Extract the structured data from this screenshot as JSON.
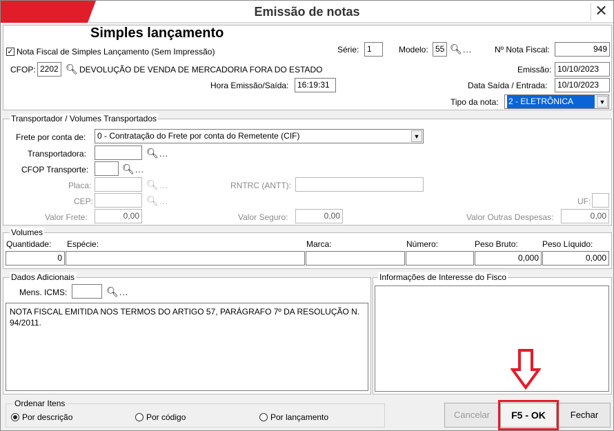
{
  "window": {
    "title": "Emissão de notas",
    "close_glyph": "✕"
  },
  "header": {
    "heading": "Simples lançamento",
    "checkbox_label": "Nota Fiscal de Simples Lançamento (Sem Impressão)",
    "serie_label": "Série:",
    "serie_value": "1",
    "modelo_label": "Modelo:",
    "modelo_value": "55",
    "numero_label": "Nº Nota Fiscal:",
    "numero_value": "949",
    "cfop_label": "CFOP:",
    "cfop_value": "2202",
    "cfop_desc": "DEVOLUÇÃO DE VENDA DE MERCADORIA FORA DO ESTADO",
    "hora_label": "Hora Emissão/Saída:",
    "hora_value": "16:19:31",
    "emissao_label": "Emissão:",
    "emissao_value": "10/10/2023",
    "saida_label": "Data Saída / Entrada:",
    "saida_value": "10/10/2023",
    "tipo_label": "Tipo da nota:",
    "tipo_value": "2 - ELETRÔNICA"
  },
  "transporte": {
    "title": "Transportador /  Volumes Transportados",
    "frete_label": "Frete por conta de:",
    "frete_value": "0 - Contratação do Frete por conta do Remetente (CIF)",
    "transportadora_label": "Transportadora:",
    "cfop_transp_label": "CFOP Transporte:",
    "placa_label": "Placa:",
    "rntrc_label": "RNTRC (ANTT):",
    "cep_label": "CEP:",
    "uf_label": "UF:",
    "valor_frete_label": "Valor Frete:",
    "valor_frete_value": "0,00",
    "valor_seguro_label": "Valor Seguro:",
    "valor_seguro_value": "0,00",
    "valor_outras_label": "Valor Outras Despesas:",
    "valor_outras_value": "0,00"
  },
  "volumes": {
    "title": "Volumes",
    "quantidade_label": "Quantidade:",
    "quantidade_value": "0",
    "especie_label": "Espécie:",
    "marca_label": "Marca:",
    "numero_label": "Número:",
    "peso_bruto_label": "Peso Bruto:",
    "peso_bruto_value": "0,000",
    "peso_liquido_label": "Peso Líquido:",
    "peso_liquido_value": "0,000"
  },
  "adicionais": {
    "title": "Dados Adicionais",
    "mens_label": "Mens. ICMS:",
    "text": "NOTA FISCAL EMITIDA NOS TERMOS DO ARTIGO 57, PARÁGRAFO 7º DA RESOLUÇÃO N. 94/2011.",
    "fisco_title": "Informações de Interesse do Fisco"
  },
  "ordenar": {
    "title": "Ordenar Itens",
    "options": [
      "Por descrição",
      "Por código",
      "Por lançamento"
    ]
  },
  "buttons": {
    "cancelar": "Cancelar",
    "ok": "F5 - OK",
    "fechar": "Fechar"
  },
  "icons": {
    "search": "search-icon",
    "dots": "..."
  },
  "colors": {
    "accent": "#e11d2a",
    "highlight": "#0a64d8"
  }
}
